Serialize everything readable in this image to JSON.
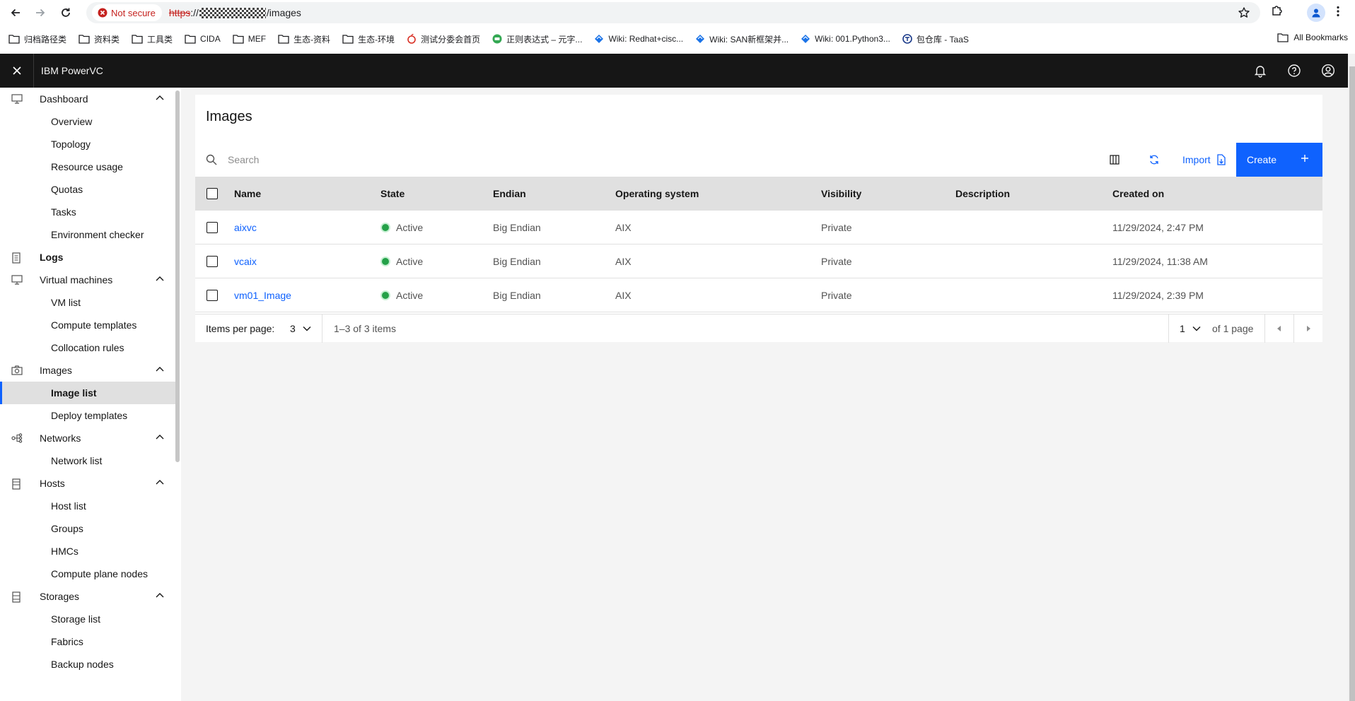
{
  "browser": {
    "not_secure": "Not secure",
    "url_protocol": "https",
    "url_sep": "://",
    "url_path": "/images",
    "all_bookmarks": "All Bookmarks",
    "bookmarks": [
      {
        "label": "归档路径类",
        "icon": "folder-icon"
      },
      {
        "label": "资料类",
        "icon": "folder-icon"
      },
      {
        "label": "工具类",
        "icon": "folder-icon"
      },
      {
        "label": "CIDA",
        "icon": "folder-icon"
      },
      {
        "label": "MEF",
        "icon": "folder-icon"
      },
      {
        "label": "生态-资料",
        "icon": "folder-icon"
      },
      {
        "label": "生态-环境",
        "icon": "folder-icon"
      },
      {
        "label": "测试分委会首页",
        "icon": "apple-icon"
      },
      {
        "label": "正则表达式 – 元字...",
        "icon": "regex-site-icon"
      },
      {
        "label": "Wiki: Redhat+cisc...",
        "icon": "wiki-diamond-icon"
      },
      {
        "label": "Wiki: SAN新框架并...",
        "icon": "wiki-diamond-icon"
      },
      {
        "label": "Wiki: 001.Python3...",
        "icon": "wiki-diamond-icon"
      },
      {
        "label": "包仓库 - TaaS",
        "icon": "taas-icon"
      }
    ]
  },
  "app": {
    "title": "IBM PowerVC"
  },
  "sidenav": {
    "dashboard": "Dashboard",
    "overview": "Overview",
    "topology": "Topology",
    "resource_usage": "Resource usage",
    "quotas": "Quotas",
    "tasks": "Tasks",
    "environment_checker": "Environment checker",
    "logs": "Logs",
    "virtual_machines": "Virtual machines",
    "vm_list": "VM list",
    "compute_templates": "Compute templates",
    "collocation_rules": "Collocation rules",
    "images": "Images",
    "image_list": "Image list",
    "deploy_templates": "Deploy templates",
    "networks": "Networks",
    "network_list": "Network list",
    "hosts": "Hosts",
    "host_list": "Host list",
    "groups": "Groups",
    "hmcs": "HMCs",
    "compute_plane_nodes": "Compute plane nodes",
    "storages": "Storages",
    "storage_list": "Storage list",
    "fabrics": "Fabrics",
    "backup_nodes": "Backup nodes"
  },
  "main": {
    "page_title": "Images",
    "search_placeholder": "Search",
    "import_label": "Import",
    "create_label": "Create",
    "columns": [
      "Name",
      "State",
      "Endian",
      "Operating system",
      "Visibility",
      "Description",
      "Created on"
    ],
    "rows": [
      {
        "name": "aixvc",
        "state": "Active",
        "endian": "Big Endian",
        "os": "AIX",
        "visibility": "Private",
        "description": "",
        "created": "11/29/2024, 2:47 PM"
      },
      {
        "name": "vcaix",
        "state": "Active",
        "endian": "Big Endian",
        "os": "AIX",
        "visibility": "Private",
        "description": "",
        "created": "11/29/2024, 11:38 AM"
      },
      {
        "name": "vm01_Image",
        "state": "Active",
        "endian": "Big Endian",
        "os": "AIX",
        "visibility": "Private",
        "description": "",
        "created": "11/29/2024, 2:39 PM"
      }
    ],
    "status_color": "#24a148",
    "accent_color": "#0f62fe",
    "pagination": {
      "items_per_page_label": "Items per page:",
      "items_per_page": "3",
      "range": "1–3 of 3 items",
      "page": "1",
      "of_pages": "of 1 page"
    }
  }
}
